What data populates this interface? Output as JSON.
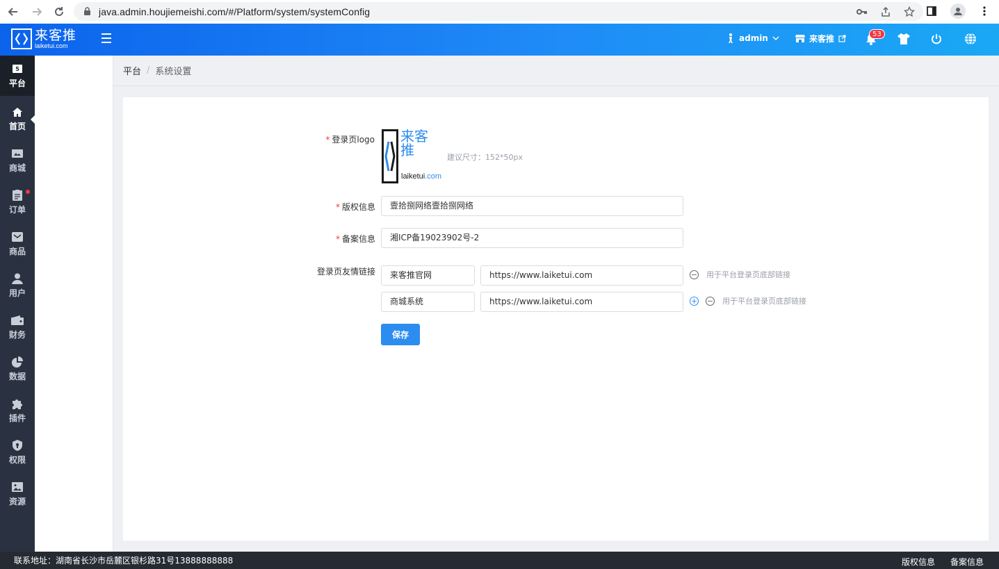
{
  "browser": {
    "url": "java.admin.houjiemeishi.com/#/Platform/system/systemConfig"
  },
  "header": {
    "logo_cn": "来客推",
    "logo_en": "laiketui.com",
    "user": "admin",
    "store": "来客推",
    "notification_count": "53"
  },
  "sidebar": {
    "items": [
      {
        "label": "平台",
        "icon": "platform-icon"
      },
      {
        "label": "首页",
        "icon": "home-icon"
      },
      {
        "label": "商城",
        "icon": "mall-icon"
      },
      {
        "label": "订单",
        "icon": "order-icon"
      },
      {
        "label": "商品",
        "icon": "goods-icon"
      },
      {
        "label": "用户",
        "icon": "user-icon"
      },
      {
        "label": "财务",
        "icon": "wallet-icon"
      },
      {
        "label": "数据",
        "icon": "pie-chart-icon"
      },
      {
        "label": "插件",
        "icon": "puzzle-icon"
      },
      {
        "label": "权限",
        "icon": "shield-icon"
      },
      {
        "label": "资源",
        "icon": "image-icon"
      }
    ]
  },
  "breadcrumb": {
    "root": "平台",
    "separator": "/",
    "current": "系统设置"
  },
  "form": {
    "logo_label": "登录页logo",
    "logo_cn": "来客推",
    "logo_en_a": "laiketui",
    "logo_en_b": ".com",
    "logo_hint": "建议尺寸：152*50px",
    "copyright_label": "版权信息",
    "copyright_value": "壹拾捌网络壹拾捌网络",
    "record_label": "备案信息",
    "record_value": "湘ICP备19023902号-2",
    "links_label": "登录页友情链接",
    "links": [
      {
        "name": "来客推官网",
        "url": "https://www.laiketui.com",
        "hint": "用于平台登录页底部链接"
      },
      {
        "name": "商城系统",
        "url": "https://www.laiketui.com",
        "hint": "用于平台登录页底部链接"
      }
    ],
    "save_label": "保存"
  },
  "footer": {
    "address": "联系地址：湖南省长沙市岳麓区银杉路31号13888888888",
    "copyright_link": "版权信息",
    "record_link": "备案信息"
  },
  "colors": {
    "header_start": "#0c63ec",
    "header_end": "#1aa8f5",
    "primary": "#2d8cf0",
    "sidebar_bg": "#2a3241",
    "required": "#f5363f"
  }
}
